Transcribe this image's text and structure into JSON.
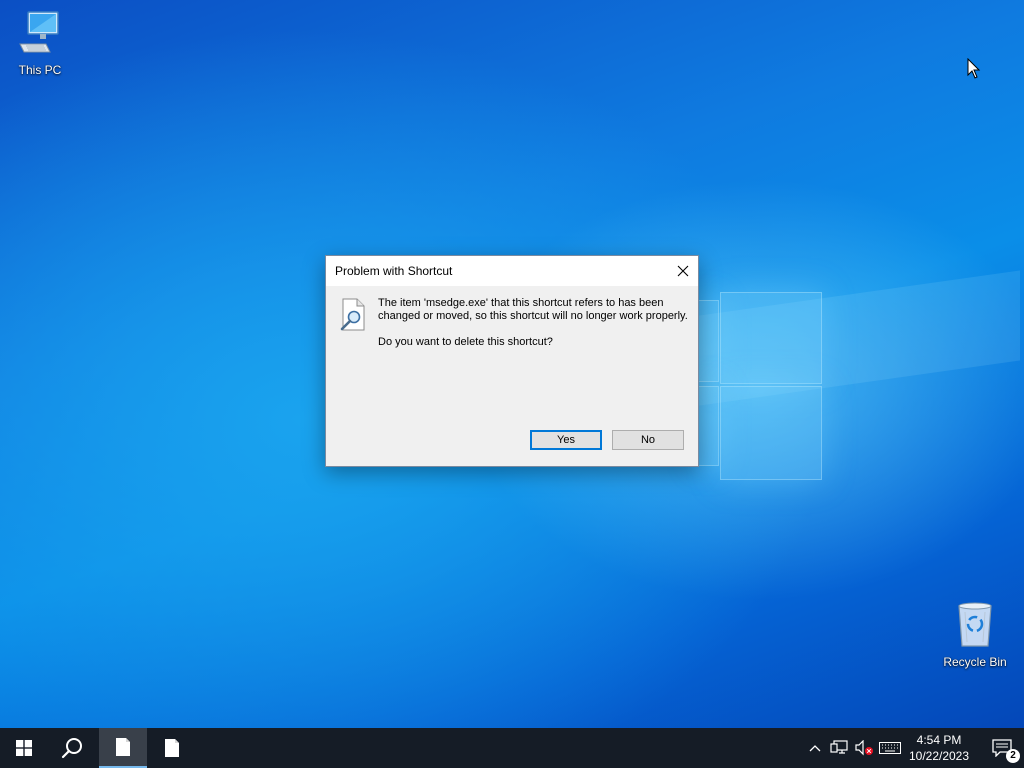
{
  "desktop": {
    "icons": [
      {
        "label": "This PC",
        "icon": "computer-icon"
      },
      {
        "label": "Recycle Bin",
        "icon": "recycle-bin-icon"
      }
    ]
  },
  "dialog": {
    "title": "Problem with Shortcut",
    "message_line1": "The item 'msedge.exe' that this shortcut refers to has been changed or moved, so this shortcut will no longer work properly.",
    "message_line2": "Do you want to delete this shortcut?",
    "icon": "missing-file-search-icon",
    "buttons": {
      "yes": "Yes",
      "no": "No"
    }
  },
  "taskbar": {
    "pinned": [
      "start-icon",
      "search-icon",
      "document-icon",
      "document-icon"
    ],
    "tray_icons": [
      "chevron-up-icon",
      "network-icon",
      "volume-muted-icon",
      "keyboard-icon"
    ],
    "time": "4:54 PM",
    "date": "10/22/2023",
    "notification_count": "2"
  },
  "colors": {
    "accent": "#0078d7",
    "taskbar": "#151c26",
    "dialog_bg": "#f0f0f0"
  }
}
